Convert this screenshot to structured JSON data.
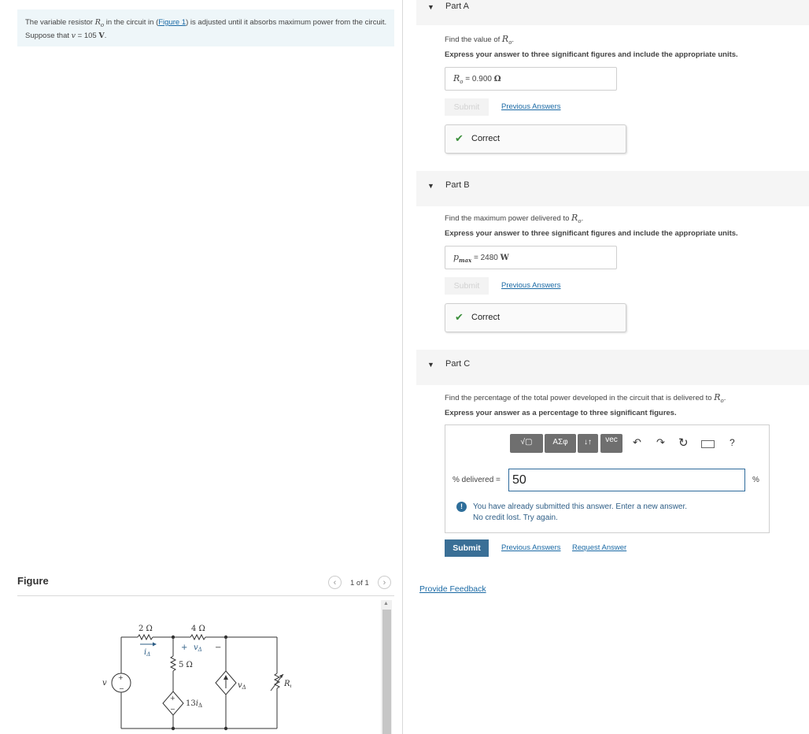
{
  "problem": {
    "text_1": "The variable resistor ",
    "var_ro": "R",
    "var_ro_sub": "o",
    "text_2": " in the circuit in (",
    "figure_link": "Figure 1",
    "text_3": ") is adjusted until it absorbs maximum power from the circuit. Suppose that ",
    "var_v": "v",
    "text_4": " = 105 ",
    "unit_v": "V",
    "text_5": "."
  },
  "figure": {
    "title": "Figure",
    "page_count": "1 of 1",
    "circuit": {
      "r2": "2 Ω",
      "r4": "4 Ω",
      "r5": "5 Ω",
      "i_delta": "i",
      "i_delta_sub": "Δ",
      "v_delta_plus": "+",
      "v_delta": "v",
      "v_delta_sub": "Δ",
      "v_delta_minus": "−",
      "src_v": "v",
      "dep_src_13": "13",
      "dep_src_i": "i",
      "dep_src_i_sub": "Δ",
      "dep_src_v": "v",
      "dep_src_v_sub": "Δ",
      "ro": "R",
      "ro_sub": "o",
      "plus": "+",
      "minus": "−"
    }
  },
  "parts": {
    "a": {
      "label": "Part A",
      "question": "Find the value of ",
      "q_var": "R",
      "q_var_sub": "o",
      "instruction": "Express your answer to three significant figures and include the appropriate units.",
      "answer_var": "R",
      "answer_var_sub": "o",
      "answer_eq": " = ",
      "answer_value": "0.900",
      "answer_unit": "Ω",
      "submit": "Submit",
      "previous": "Previous Answers",
      "status": "Correct"
    },
    "b": {
      "label": "Part B",
      "question": "Find the maximum power delivered to ",
      "q_var": "R",
      "q_var_sub": "o",
      "instruction": "Express your answer to three significant figures and include the appropriate units.",
      "answer_var": "p",
      "answer_var_sub": "max",
      "answer_eq": " = ",
      "answer_value": "2480",
      "answer_unit": "W",
      "submit": "Submit",
      "previous": "Previous Answers",
      "status": "Correct"
    },
    "c": {
      "label": "Part C",
      "question": "Find the percentage of the total power developed in the circuit that is delivered to ",
      "q_var": "R",
      "q_var_sub": "o",
      "instruction": "Express your answer as a percentage to three significant figures.",
      "toolbar": {
        "templates": "√▢",
        "greek": "ΑΣφ",
        "arrows": "↓↑",
        "vec": "vec",
        "undo_icon": "undo-icon",
        "redo_icon": "redo-icon",
        "reset_icon": "reset-icon",
        "keyboard_icon": "keyboard-icon",
        "help": "?"
      },
      "input_label": "% delivered = ",
      "input_value": "50",
      "unit": "%",
      "warning_line1": "You have already submitted this answer. Enter a new answer.",
      "warning_line2": "No credit lost. Try again.",
      "submit": "Submit",
      "previous": "Previous Answers",
      "request": "Request Answer"
    }
  },
  "feedback": "Provide Feedback",
  "colors": {
    "link": "#1b6aa5",
    "correct_check": "#3b8f3b",
    "submit_active": "#3a6f96",
    "problem_bg": "#eef6f9",
    "part_header_bg": "#f5f5f5"
  }
}
